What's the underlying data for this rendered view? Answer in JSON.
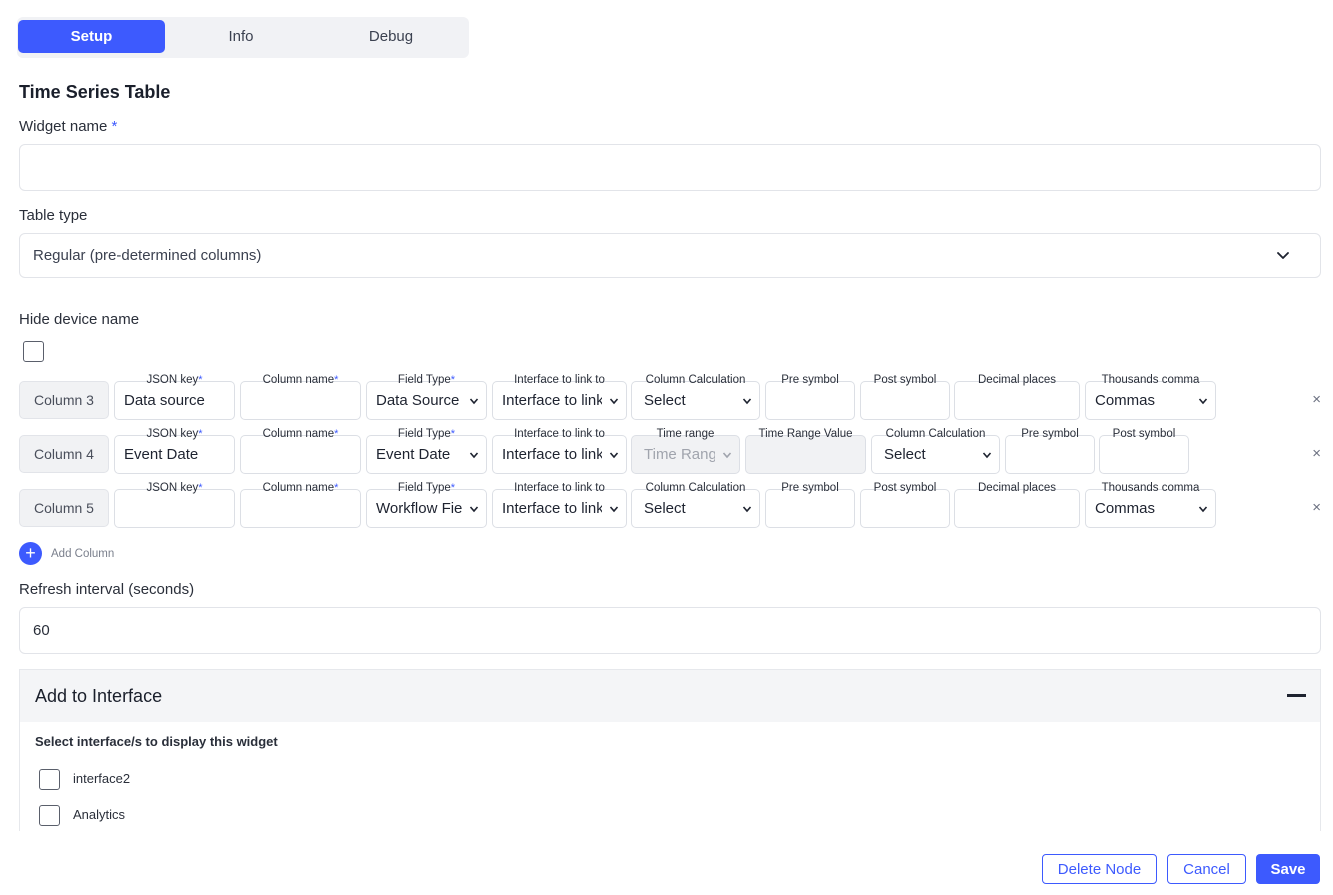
{
  "tabs": [
    {
      "label": "Setup"
    },
    {
      "label": "Info"
    },
    {
      "label": "Debug"
    }
  ],
  "form": {
    "title": "Time Series Table",
    "widget_name_label": "Widget name",
    "required_mark": "*",
    "widget_name_value": "",
    "table_type_label": "Table type",
    "table_type_value": "Regular (pre-determined columns)",
    "hide_device_label": "Hide device name",
    "hide_device_checked": false,
    "refresh_label": "Refresh interval (seconds)",
    "refresh_value": "60"
  },
  "columns": {
    "row1": {
      "tag": "Column 3",
      "json_key_label": "JSON key",
      "json_key_value": "Data source",
      "column_name_label": "Column name",
      "column_name_value": "",
      "field_type_label": "Field Type",
      "field_type_value": "Data Source",
      "interface_label": "Interface to link to",
      "interface_value": "Interface to link to",
      "calc_label": "Column Calculation",
      "calc_value": "Select",
      "pre_label": "Pre symbol",
      "post_label": "Post symbol",
      "decimal_label": "Decimal places",
      "thousands_label": "Thousands comma",
      "thousands_value": "Commas",
      "remove": "×"
    },
    "row2": {
      "tag": "Column 4",
      "json_key_label": "JSON key",
      "json_key_value": "Event Date",
      "column_name_label": "Column name",
      "column_name_value": "",
      "field_type_label": "Field Type",
      "field_type_value": "Event Date",
      "interface_label": "Interface to link to",
      "interface_value": "Interface to link to",
      "time_range_label": "Time range",
      "time_range_value": "Time Range",
      "time_range_value_label": "Time Range Value",
      "calc_label": "Column Calculation",
      "calc_value": "Select",
      "pre_label": "Pre symbol",
      "post_label": "Post symbol",
      "remove": "×"
    },
    "row3": {
      "tag": "Column 5",
      "json_key_label": "JSON key",
      "json_key_value": "",
      "column_name_label": "Column name",
      "column_name_value": "",
      "field_type_label": "Field Type",
      "field_type_value": "Workflow Field",
      "interface_label": "Interface to link to",
      "interface_value": "Interface to link to",
      "calc_label": "Column Calculation",
      "calc_value": "Select",
      "pre_label": "Pre symbol",
      "post_label": "Post symbol",
      "decimal_label": "Decimal places",
      "thousands_label": "Thousands comma",
      "thousands_value": "Commas",
      "remove": "×"
    },
    "add_label": "Add Column",
    "add_icon": "+"
  },
  "interface_panel": {
    "title": "Add to Interface",
    "subtitle": "Select interface/s to display this widget",
    "options": [
      {
        "label": "interface2",
        "checked": false
      },
      {
        "label": "Analytics",
        "checked": false
      }
    ]
  },
  "footer": {
    "delete_label": "Delete Node",
    "cancel_label": "Cancel",
    "save_label": "Save"
  },
  "colors": {
    "accent": "#3d5afe",
    "border": "#e2e4e9",
    "panel_header": "#f4f5f7"
  }
}
